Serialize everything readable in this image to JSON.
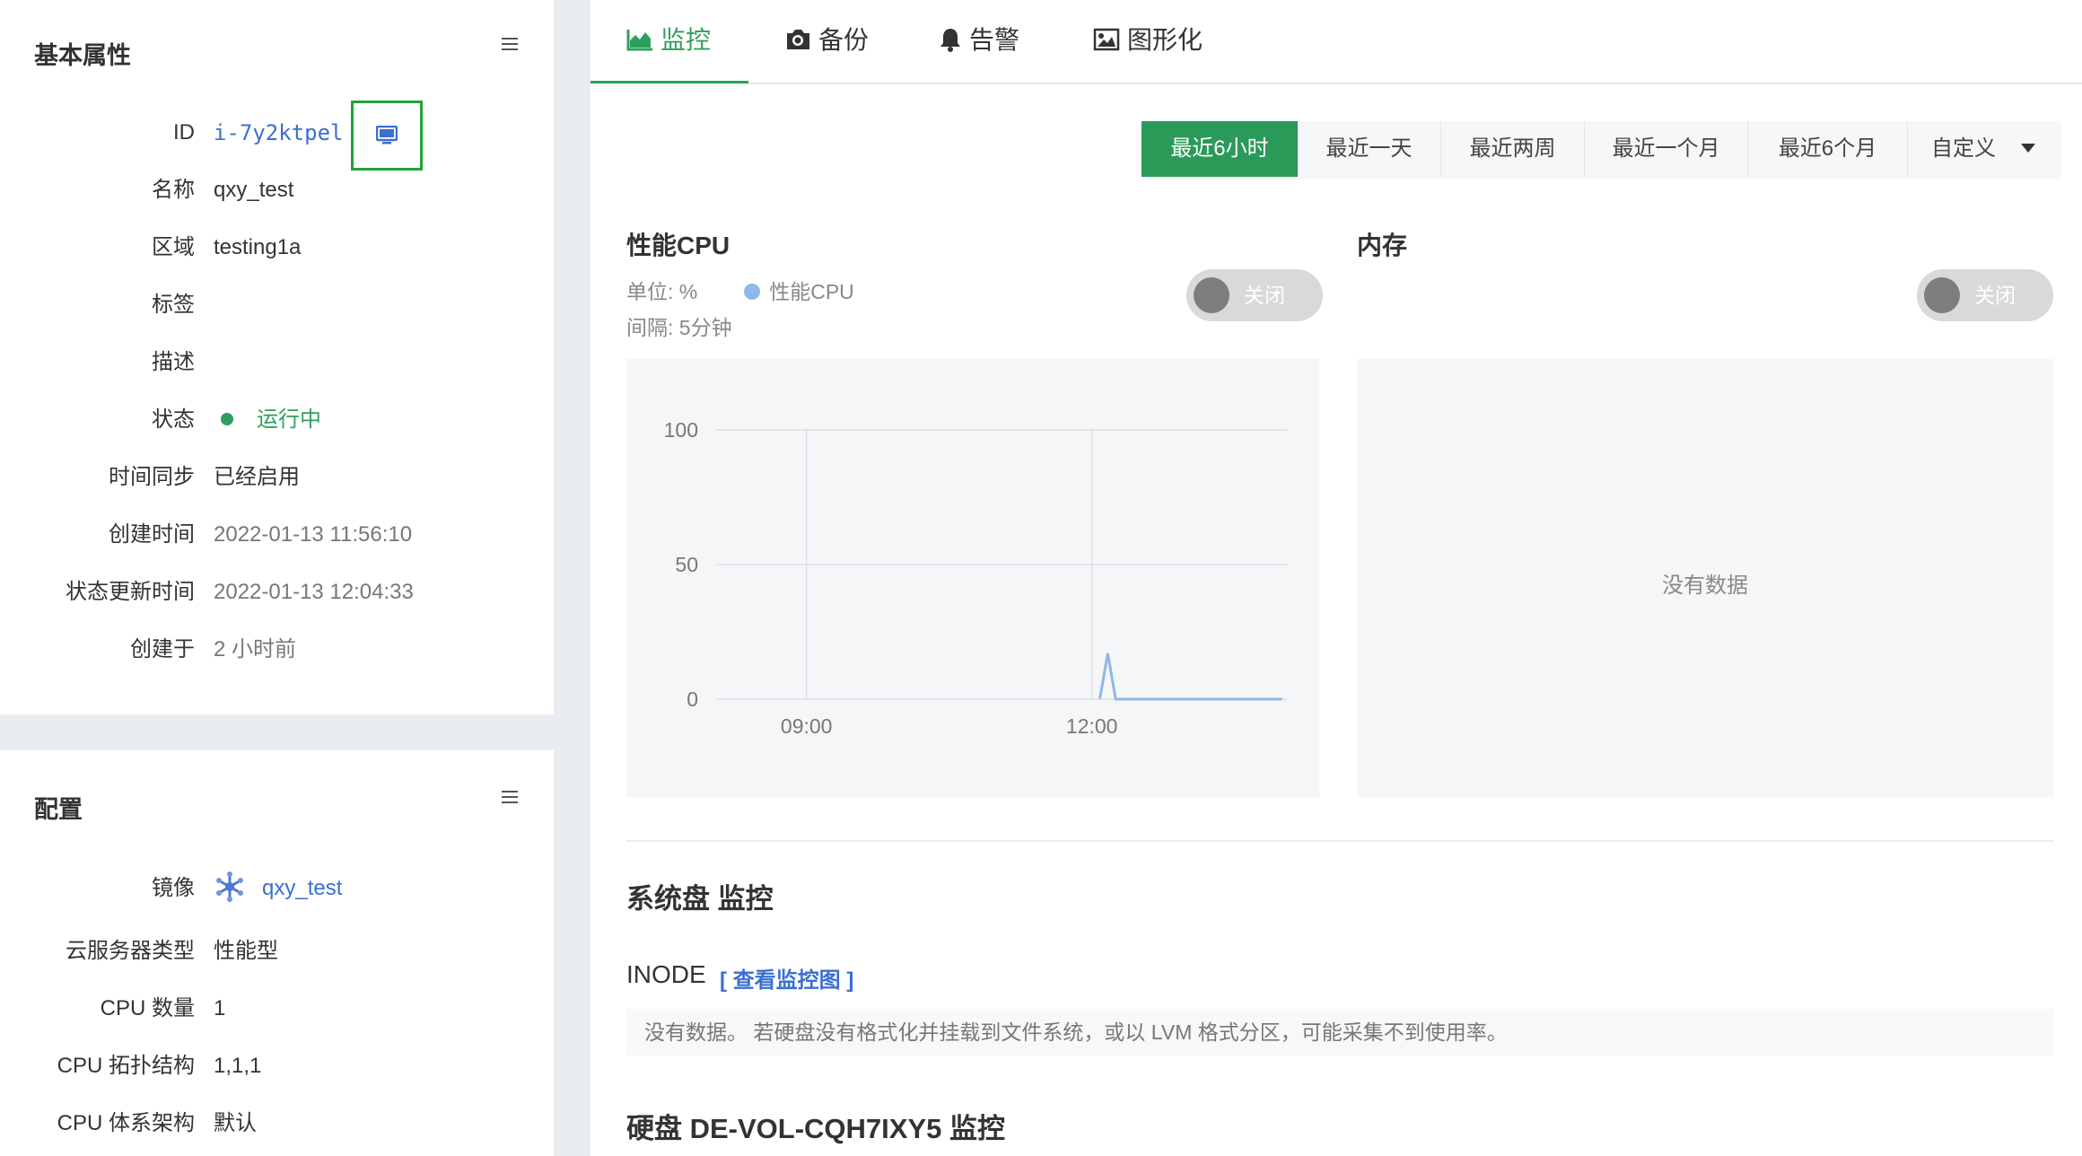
{
  "basic": {
    "title": "基本属性",
    "rows": [
      {
        "label": "ID",
        "value": "i-7y2ktpel"
      },
      {
        "label": "名称",
        "value": "qxy_test"
      },
      {
        "label": "区域",
        "value": "testing1a"
      },
      {
        "label": "标签",
        "value": ""
      },
      {
        "label": "描述",
        "value": ""
      },
      {
        "label": "状态",
        "value": "运行中"
      },
      {
        "label": "时间同步",
        "value": "已经启用"
      },
      {
        "label": "创建时间",
        "value": "2022-01-13 11:56:10"
      },
      {
        "label": "状态更新时间",
        "value": "2022-01-13 12:04:33"
      },
      {
        "label": "创建于",
        "value": "2 小时前"
      }
    ]
  },
  "config": {
    "title": "配置",
    "rows": [
      {
        "label": "镜像",
        "value": "qxy_test"
      },
      {
        "label": "云服务器类型",
        "value": "性能型"
      },
      {
        "label": "CPU 数量",
        "value": "1"
      },
      {
        "label": "CPU 拓扑结构",
        "value": "1,1,1"
      },
      {
        "label": "CPU 体系架构",
        "value": "默认"
      }
    ]
  },
  "tabs": [
    {
      "label": "监控",
      "icon": "area-chart-icon",
      "active": true
    },
    {
      "label": "备份",
      "icon": "camera-icon"
    },
    {
      "label": "告警",
      "icon": "bell-icon"
    },
    {
      "label": "图形化",
      "icon": "image-icon"
    }
  ],
  "time_ranges": [
    "最近6小时",
    "最近一天",
    "最近两周",
    "最近一个月",
    "最近6个月",
    "自定义"
  ],
  "active_range": "最近6小时",
  "cpu": {
    "title": "性能CPU",
    "unit": "单位: %",
    "legend": "性能CPU",
    "interval": "间隔: 5分钟",
    "toggle": "关闭"
  },
  "memory": {
    "title": "内存",
    "toggle": "关闭",
    "empty": "没有数据"
  },
  "chart_data": {
    "type": "line",
    "title": "性能CPU",
    "ylabel": "单位: %",
    "ylim": [
      0,
      100
    ],
    "yticks": [
      0,
      50,
      100
    ],
    "xticks": [
      "09:00",
      "12:00"
    ],
    "grid": true,
    "color": "#8fb9e6",
    "series": [
      {
        "name": "性能CPU",
        "x": [
          "12:05",
          "12:10",
          "12:15",
          "12:20",
          "12:30",
          "12:45",
          "13:00",
          "13:15",
          "13:30",
          "13:45",
          "14:00"
        ],
        "values": [
          0,
          17,
          0,
          0,
          0,
          0,
          0,
          0,
          0,
          0,
          0
        ]
      }
    ]
  },
  "disk": {
    "title": "系统盘 监控",
    "inode_label": "INODE",
    "inode_link": "[ 查看监控图 ]",
    "note": "没有数据。 若硬盘没有格式化并挂载到文件系统，或以 LVM 格式分区，可能采集不到使用率。",
    "second_title": "硬盘 DE-VOL-CQH7IXY5 监控"
  },
  "colors": {
    "accent": "#2a9a59",
    "link": "#3a6fd0",
    "status_running": "#2ea05c",
    "vnc_highlight": "#1fa33b"
  }
}
